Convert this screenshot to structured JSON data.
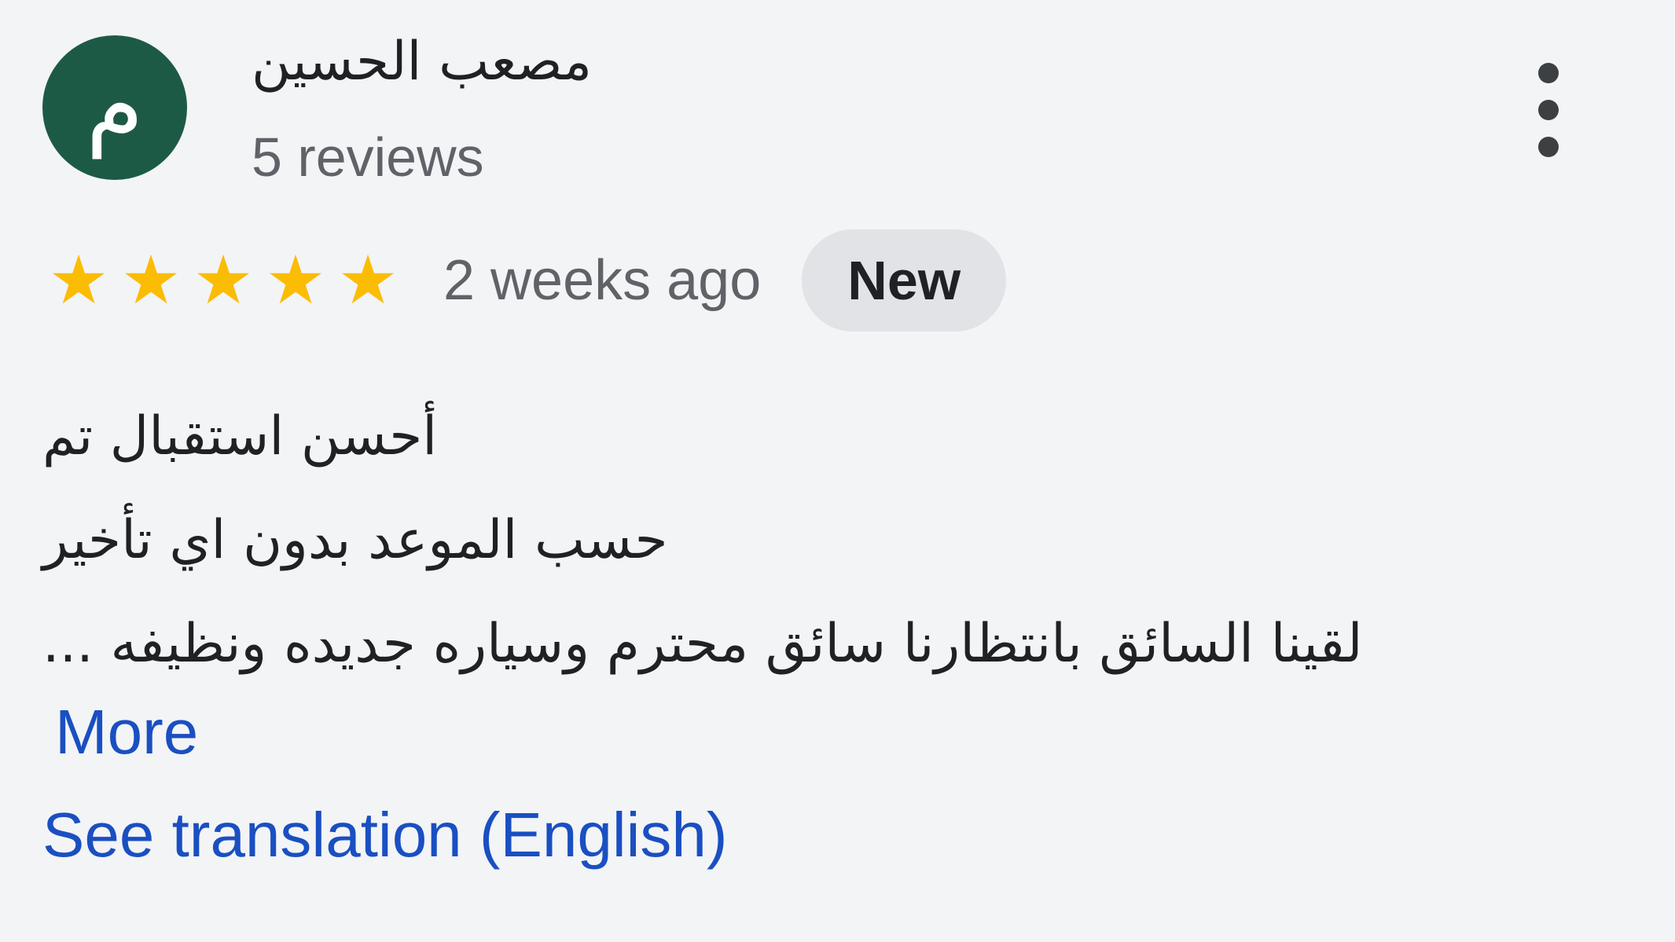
{
  "reviewer": {
    "avatar_letter": "م",
    "avatar_color": "#1d5a46",
    "name": "مصعب الحسين",
    "review_count": "5 reviews"
  },
  "menu": {
    "icon": "more-vert-icon"
  },
  "rating": {
    "stars": 5,
    "max_stars": 5,
    "star_glyph": "★",
    "star_color": "#fbbc04",
    "time_ago": "2 weeks ago",
    "badge": "New"
  },
  "review": {
    "lines": [
      "أحسن استقبال تم",
      "حسب الموعد بدون اي تأخير",
      "لقينا السائق بانتظارنا سائق محترم وسياره جديده ونظيفه ..."
    ],
    "more_label": "More",
    "translate_label": "See translation (English)",
    "link_color": "#1a4fc2"
  }
}
